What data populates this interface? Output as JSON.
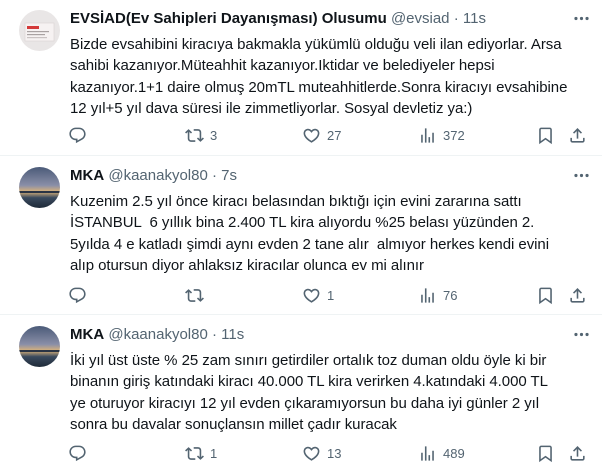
{
  "tweets": [
    {
      "name": "EVSİAD(Ev Sahipleri Dayanışması) Olusumu",
      "handle": "@evsiad",
      "dot": "·",
      "time": "11s",
      "text": "Bizde evsahibini kiracıya bakmakla yükümlü olduğu veli ilan ediyorlar. Arsa\nsahibi kazanıyor.Müteahhit kazanıyor.Iktidar ve belediyeler hepsi\nkazanıyor.1+1 daire olmuş 20mTL muteahhitlerde.Sonra kiracıyı evsahibine\n12 yıl+5 yıl dava süresi ile zimmetliyorlar. Sosyal devletiz ya:)",
      "replies": "",
      "retweets": "3",
      "likes": "27",
      "views": "372",
      "avatar_icon": "document-logo-avatar"
    },
    {
      "name": "MKA",
      "handle": "@kaanakyol80",
      "dot": "·",
      "time": "7s",
      "text": "Kuzenim 2.5 yıl önce kiracı belasından bıktığı için evini zararına sattı\nİSTANBUL  6 yıllık bina 2.400 TL kira alıyordu %25 belası yüzünden 2.\n5yılda 4 e katladı şimdi aynı evden 2 tane alır  almıyor herkes kendi evini\nalıp otursun diyor ahlaksız kiracılar olunca ev mi alınır",
      "replies": "",
      "retweets": "",
      "likes": "1",
      "views": "76",
      "avatar_icon": "sunset-avatar"
    },
    {
      "name": "MKA",
      "handle": "@kaanakyol80",
      "dot": "·",
      "time": "11s",
      "text": "İki yıl üst üste % 25 zam sınırı getirdiler ortalık toz duman oldu öyle ki bir\nbinanın giriş katındaki kiracı 40.000 TL kira verirken 4.katındaki 4.000 TL\nye oturuyor kiracıyı 12 yıl evden çıkaramıyorsun bu daha iyi günler 2 yıl\nsonra bu davalar sonuçlansın millet çadır kuracak",
      "replies": "",
      "retweets": "1",
      "likes": "13",
      "views": "489",
      "avatar_icon": "sunset-avatar"
    }
  ],
  "colors": {
    "text": "#0f1419",
    "secondary": "#536471",
    "divider": "#eff3f4"
  },
  "icons": [
    "reply-icon",
    "retweet-icon",
    "like-icon",
    "views-icon",
    "bookmark-icon",
    "share-icon",
    "more-icon"
  ]
}
